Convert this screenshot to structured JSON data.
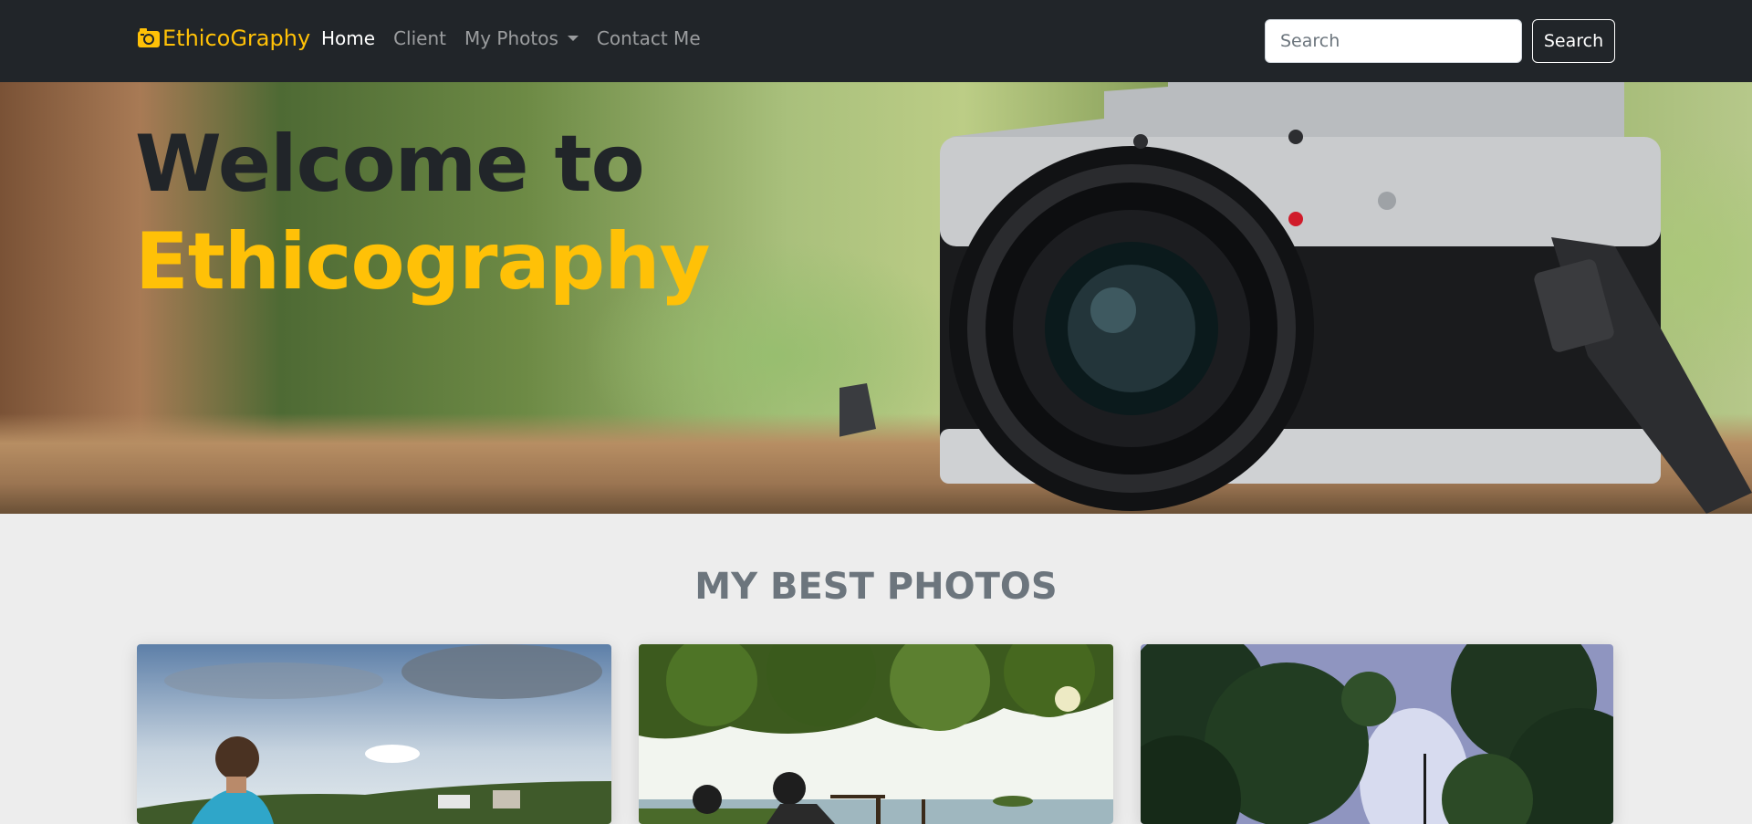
{
  "navbar": {
    "brand": "EthicoGraphy",
    "brand_icon": "camera-icon",
    "links": [
      {
        "label": "Home",
        "active": true
      },
      {
        "label": "Client",
        "active": false
      },
      {
        "label": "My Photos",
        "active": false,
        "dropdown": true
      },
      {
        "label": "Contact Me",
        "active": false
      }
    ],
    "search_placeholder": "Search",
    "search_button": "Search"
  },
  "hero": {
    "line1": "Welcome to",
    "line2": "Ethicography"
  },
  "gallery": {
    "title": "MY BEST PHOTOS",
    "cards": [
      {
        "image": "boy-by-lake-photo"
      },
      {
        "image": "kids-under-tree-photo"
      },
      {
        "image": "forest-canopy-photo"
      }
    ]
  },
  "colors": {
    "accent": "#ffc107",
    "navbar_bg": "#212529",
    "section_bg": "#ededed",
    "title_gray": "#6c757d"
  }
}
